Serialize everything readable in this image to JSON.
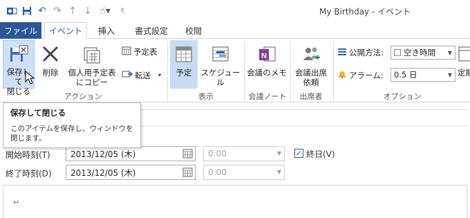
{
  "window": {
    "title": "My Birthday - イベント"
  },
  "qat": {
    "icons": [
      "outlook-icon",
      "save-icon",
      "undo-icon",
      "redo-icon",
      "up-icon",
      "down-icon",
      "touch-mode-icon",
      "customize-icon"
    ]
  },
  "tabs": [
    {
      "label": "ファイル"
    },
    {
      "label": "イベント"
    },
    {
      "label": "挿入"
    },
    {
      "label": "書式設定"
    },
    {
      "label": "校閲"
    }
  ],
  "ribbon": {
    "save_close": "保存して閉じる",
    "save_close_l1": "保存して",
    "save_close_l2": "閉じる",
    "delete": "削除",
    "copy_personal_l1": "個人用予定表",
    "copy_personal_l2": "にコピー",
    "calendar": "予定表",
    "forward": "転送",
    "group_action": "アクション",
    "appointment": "予定",
    "schedule": "スケジュール",
    "group_show": "表示",
    "meeting_notes": "会議のメモ",
    "group_meeting_notes": "会議ノート",
    "invite_l1": "会議出席",
    "invite_l2": "依頼",
    "group_attendees": "出席者",
    "show_as_label": "公開方法:",
    "show_as_value": "空き時間",
    "reminder_label": "アラーム:",
    "reminder_value": "0.5 日",
    "recurrence_l1": "定期",
    "group_options": "オプション"
  },
  "tooltip": {
    "title": "保存して閉じる",
    "body": "このアイテムを保存し、ウィンドウを閉じます。"
  },
  "form": {
    "start_label": "開始時刻(T)",
    "start_date": "2013/12/05 (木)",
    "start_time": "0:00",
    "allday_label": "終日(V)",
    "allday_checked": true,
    "end_label": "終了時刻(D)",
    "end_date": "2013/12/05 (木)",
    "end_time": "0:00",
    "body_mark": "↵"
  },
  "colors": {
    "accent": "#2b579a",
    "hover": "#cde0f5"
  }
}
